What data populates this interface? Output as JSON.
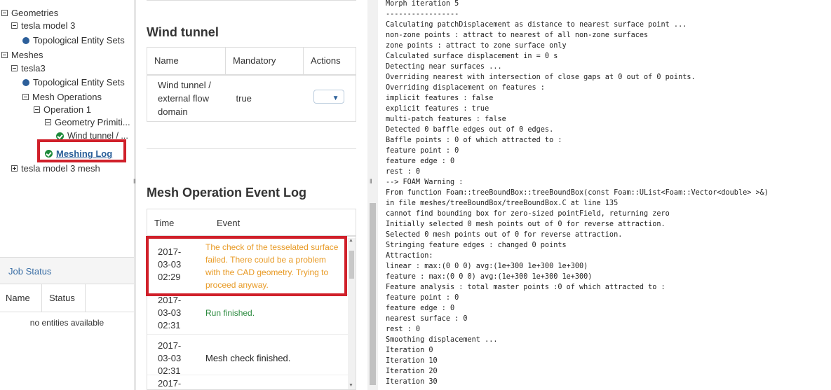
{
  "tree": {
    "items": [
      {
        "label": "Geometries",
        "type": "toggle-open"
      },
      {
        "label": "tesla model 3",
        "type": "toggle-open"
      },
      {
        "label": "Topological Entity Sets",
        "type": "dot"
      },
      {
        "label": "Meshes",
        "type": "toggle-open"
      },
      {
        "label": "tesla3",
        "type": "toggle-open"
      },
      {
        "label": "Topological Entity Sets",
        "type": "dot"
      },
      {
        "label": "Mesh Operations",
        "type": "toggle-open"
      },
      {
        "label": "Operation 1",
        "type": "toggle-open"
      },
      {
        "label": "Geometry Primiti...",
        "type": "toggle-open"
      },
      {
        "label": "Wind tunnel / ...",
        "type": "check"
      },
      {
        "label": "Meshing Log",
        "type": "check"
      },
      {
        "label": "tesla model 3 mesh",
        "type": "toggle-closed"
      }
    ]
  },
  "job_status": {
    "title": "Job Status",
    "columns": [
      "Name",
      "Status"
    ],
    "empty_text": "no entities available"
  },
  "wind_tunnel": {
    "title": "Wind tunnel",
    "columns": [
      "Name",
      "Mandatory",
      "Actions"
    ],
    "row": {
      "name": "Wind tunnel / external flow domain",
      "mandatory": "true",
      "action_arrow": "▼"
    }
  },
  "event_log": {
    "title": "Mesh Operation Event Log",
    "columns": [
      "Time",
      "Event"
    ],
    "rows": [
      {
        "time": [
          "2017-",
          "03-03",
          "02:29"
        ],
        "event": "The check of the tesselated surface failed. There could be a problem with the CAD geometry. Trying to proceed anyway.",
        "status": "warning"
      },
      {
        "time": [
          "2017-",
          "03-03",
          "02:31"
        ],
        "event": "Run finished.",
        "status": "success"
      },
      {
        "time": [
          "2017-",
          "03-03",
          "02:31"
        ],
        "event": "Mesh check finished.",
        "status": "info"
      },
      {
        "time": [
          "2017-",
          "",
          ""
        ],
        "event": "",
        "status": "info"
      }
    ]
  },
  "log_lines": [
    "Morph iteration 5",
    "-----------------",
    "Calculating patchDisplacement as distance to nearest surface point ...",
    "non-zone points : attract to nearest of all non-zone surfaces",
    "zone points : attract to zone surface only",
    "Calculated surface displacement in = 0 s",
    "Detecting near surfaces ...",
    "Overriding nearest with intersection of close gaps at 0 out of 0 points.",
    "Overriding displacement on features :",
    "implicit features : false",
    "explicit features : true",
    "multi-patch features : false",
    "Detected 0 baffle edges out of 0 edges.",
    "Baffle points : 0 of which attracted to :",
    "feature point : 0",
    "feature edge : 0",
    "rest : 0",
    "--> FOAM Warning :",
    "From function Foam::treeBoundBox::treeBoundBox(const Foam::UList<Foam::Vector<double> >&)",
    "in file meshes/treeBoundBox/treeBoundBox.C at line 135",
    "cannot find bounding box for zero-sized pointField, returning zero",
    "Initially selected 0 mesh points out of 0 for reverse attraction.",
    "Selected 0 mesh points out of 0 for reverse attraction.",
    "Stringing feature edges : changed 0 points",
    "Attraction:",
    "linear : max:(0 0 0) avg:(1e+300 1e+300 1e+300)",
    "feature : max:(0 0 0) avg:(1e+300 1e+300 1e+300)",
    "Feature analysis : total master points :0 of which attracted to :",
    "feature point : 0",
    "feature edge : 0",
    "nearest surface : 0",
    "rest : 0",
    "Smoothing displacement ...",
    "Iteration 0",
    "Iteration 10",
    "Iteration 20",
    "Iteration 30"
  ],
  "colors": {
    "highlight": "#d0202a",
    "warning": "#e89a25",
    "success": "#2b8a3e",
    "link": "#2a5f99"
  }
}
